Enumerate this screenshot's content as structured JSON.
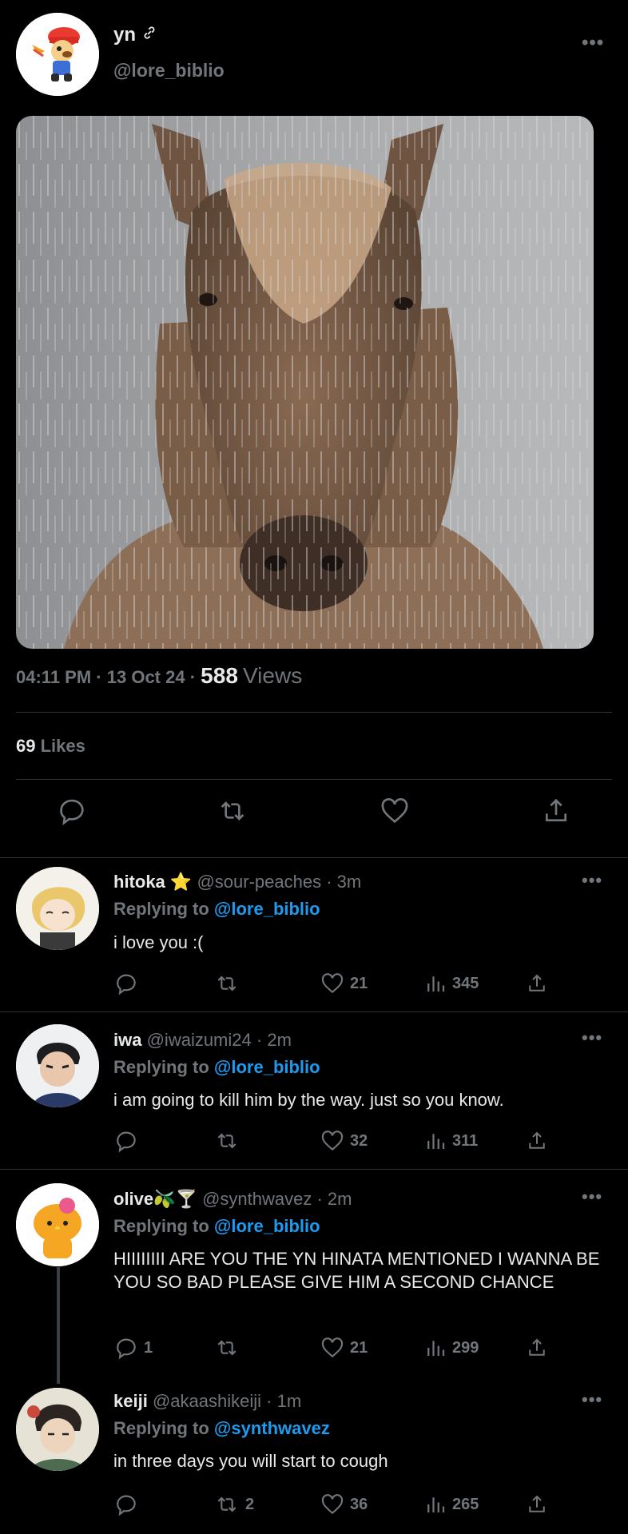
{
  "author": {
    "display_name": "yn",
    "handle": "@lore_biblio",
    "avatar": "parappa-avatar"
  },
  "icons": {
    "link": "link-icon",
    "more": "more-dots-icon",
    "reply": "reply-icon",
    "retweet": "retweet-icon",
    "like": "heart-icon",
    "views": "views-chart-icon",
    "share": "share-icon"
  },
  "media": {
    "description_icon": "horse-in-rain-image"
  },
  "tweet": {
    "time": "04:11 PM",
    "sep1": "·",
    "date": "13 Oct 24",
    "sep2": "·",
    "views": "588",
    "views_label": "Views",
    "likes": "69",
    "likes_label": "Likes"
  },
  "more_glyph": "•••",
  "replies": [
    {
      "name": "hitoka",
      "name_emoji": "⭐",
      "handle": "@sour-peaches",
      "sep": "·",
      "time": "3m",
      "replying_label": "Replying to",
      "replying_to": "@lore_biblio",
      "text": "i love you :(",
      "reply_count": "",
      "retweet_count": "",
      "like_count": "21",
      "view_count": "345"
    },
    {
      "name": "iwa",
      "name_emoji": "",
      "handle": "@iwaizumi24",
      "sep": "·",
      "time": "2m",
      "replying_label": "Replying to",
      "replying_to": "@lore_biblio",
      "text": "i am going to kill him by the way. just so you know.",
      "reply_count": "",
      "retweet_count": "",
      "like_count": "32",
      "view_count": "311"
    },
    {
      "name": "olive",
      "name_emoji": "🫒🍸",
      "handle": "@synthwavez",
      "sep": "·",
      "time": "2m",
      "replying_label": "Replying to",
      "replying_to": "@lore_biblio",
      "text": "HIIIIIIII ARE YOU THE YN HINATA MENTIONED I WANNA BE YOU SO BAD PLEASE GIVE HIM A SECOND CHANCE",
      "reply_count": "1",
      "retweet_count": "",
      "like_count": "21",
      "view_count": "299"
    },
    {
      "name": "keiji",
      "name_emoji": "",
      "handle": "@akaashikeiji",
      "sep": "·",
      "time": "1m",
      "replying_label": "Replying to",
      "replying_to": "@synthwavez",
      "text": "in three days you will start to cough",
      "reply_count": "",
      "retweet_count": "2",
      "like_count": "36",
      "view_count": "265"
    }
  ],
  "colors": {
    "background": "#000000",
    "text": "#e7e9ea",
    "muted": "#71767b",
    "link": "#1d9bf0",
    "divider": "#2f3336"
  }
}
